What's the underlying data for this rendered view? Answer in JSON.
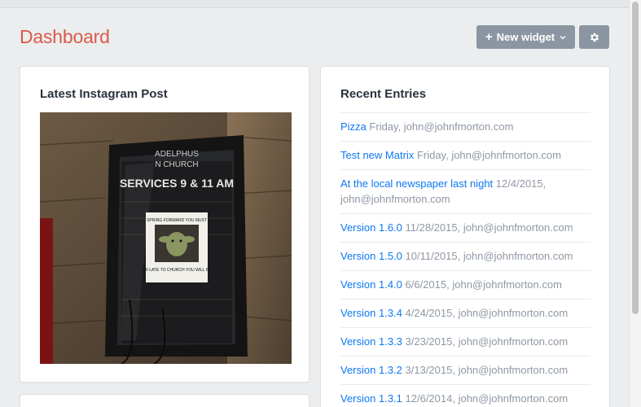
{
  "header": {
    "title": "Dashboard",
    "new_widget_label": "New widget",
    "plus_icon": "+",
    "chevron_icon": "⌄",
    "settings_icon": "gear-icon"
  },
  "colors": {
    "title": "#da5a47",
    "link": "#0d78f2",
    "button": "#8b96a2",
    "background": "#ebedef"
  },
  "instagram": {
    "title": "Latest Instagram Post",
    "photo_sign": {
      "line1": "ADELPHUS",
      "line2": "N CHURCH",
      "services": "SERVICES 9 & 11 AM",
      "poster_top": "SPRING FORWARD YOU MUST",
      "poster_bottom": "OR LATE TO CHURCH YOU WILL BE"
    }
  },
  "recent_entries": {
    "title": "Recent Entries",
    "items": [
      {
        "title": "Pizza",
        "meta": "Friday, john@johnfmorton.com"
      },
      {
        "title": "Test new Matrix",
        "meta": "Friday, john@johnfmorton.com"
      },
      {
        "title": "At the local newspaper last night",
        "meta": "12/4/2015, john@johnfmorton.com"
      },
      {
        "title": "Version 1.6.0",
        "meta": "11/28/2015, john@johnfmorton.com"
      },
      {
        "title": "Version 1.5.0",
        "meta": "10/11/2015, john@johnfmorton.com"
      },
      {
        "title": "Version 1.4.0",
        "meta": "6/6/2015, john@johnfmorton.com"
      },
      {
        "title": "Version 1.3.4",
        "meta": "4/24/2015, john@johnfmorton.com"
      },
      {
        "title": "Version 1.3.3",
        "meta": "3/23/2015, john@johnfmorton.com"
      },
      {
        "title": "Version 1.3.2",
        "meta": "3/13/2015, john@johnfmorton.com"
      },
      {
        "title": "Version 1.3.1",
        "meta": "12/6/2014, john@johnfmorton.com"
      }
    ]
  }
}
